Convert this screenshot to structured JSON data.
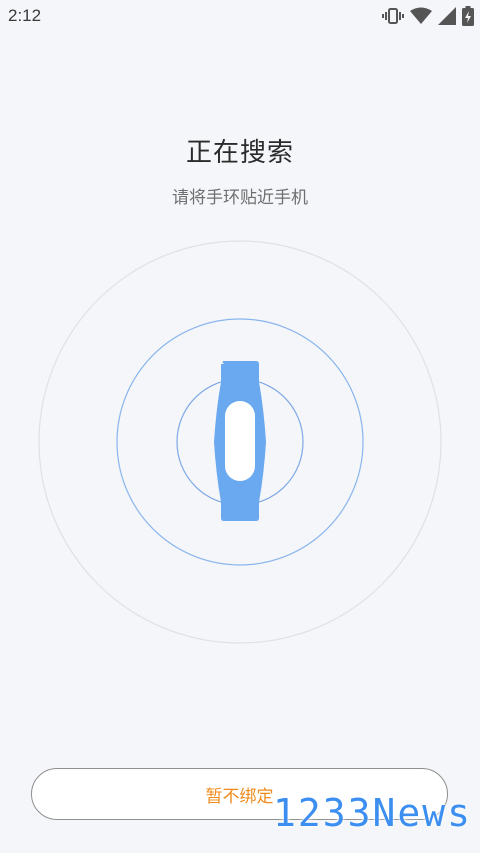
{
  "status_bar": {
    "time": "2:12",
    "icons": [
      "vibrate-icon",
      "wifi-icon",
      "cell-signal-icon",
      "battery-charging-icon"
    ]
  },
  "search": {
    "title": "正在搜索",
    "subtitle": "请将手环贴近手机"
  },
  "actions": {
    "skip_label": "暂不绑定"
  },
  "watermark": {
    "text": "1233News"
  },
  "colors": {
    "background": "#f4f6f9",
    "band": "#6aa8f0",
    "band_screen": "#ffffff",
    "ring": "#7fb0ef",
    "outer_ring": "#d9dde5",
    "accent": "#f08c1e",
    "watermark": "#3c8ef0"
  }
}
